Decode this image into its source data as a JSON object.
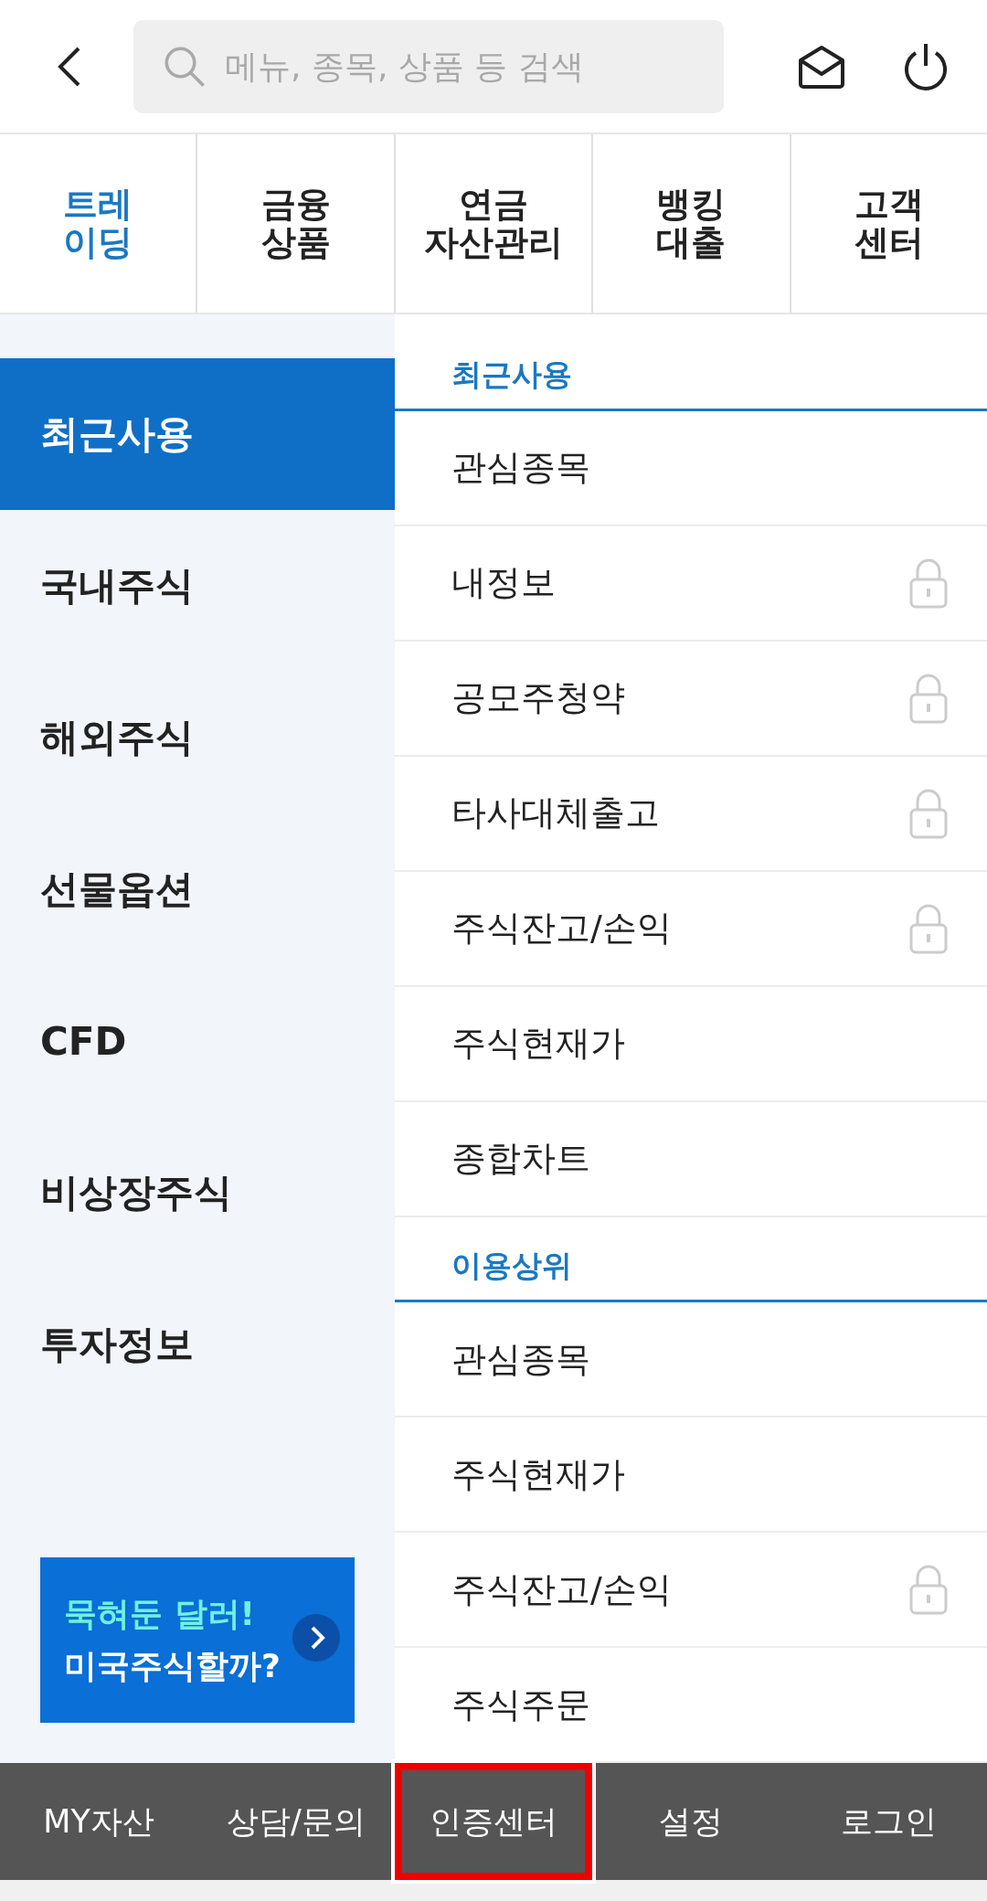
{
  "search": {
    "placeholder": "메뉴, 종목, 상품 등 검색"
  },
  "tabs": [
    {
      "label": "트레\n이딩",
      "selected": true
    },
    {
      "label": "금융\n상품",
      "selected": false
    },
    {
      "label": "연금\n자산관리",
      "selected": false
    },
    {
      "label": "뱅킹\n대출",
      "selected": false
    },
    {
      "label": "고객\n센터",
      "selected": false
    }
  ],
  "sidebar": {
    "items": [
      {
        "label": "최근사용",
        "selected": true
      },
      {
        "label": "국내주식",
        "selected": false
      },
      {
        "label": "해외주식",
        "selected": false
      },
      {
        "label": "선물옵션",
        "selected": false
      },
      {
        "label": "CFD",
        "selected": false
      },
      {
        "label": "비상장주식",
        "selected": false
      },
      {
        "label": "투자정보",
        "selected": false
      }
    ],
    "banner": {
      "line_1": "묵혀둔 달러!",
      "line_2": "미국주식할까?"
    }
  },
  "sections": [
    {
      "title": "최근사용",
      "items": [
        {
          "label": "관심종목",
          "locked": false
        },
        {
          "label": "내정보",
          "locked": true
        },
        {
          "label": "공모주청약",
          "locked": true
        },
        {
          "label": "타사대체출고",
          "locked": true
        },
        {
          "label": "주식잔고/손익",
          "locked": true
        },
        {
          "label": "주식현재가",
          "locked": false
        },
        {
          "label": "종합차트",
          "locked": false
        }
      ]
    },
    {
      "title": "이용상위",
      "items": [
        {
          "label": "관심종목",
          "locked": false
        },
        {
          "label": "주식현재가",
          "locked": false
        },
        {
          "label": "주식잔고/손익",
          "locked": true
        },
        {
          "label": "주식주문",
          "locked": false
        }
      ]
    }
  ],
  "bottom_bar": [
    {
      "label": "MY자산",
      "highlighted": false
    },
    {
      "label": "상담/문의",
      "highlighted": false
    },
    {
      "label": "인증센터",
      "highlighted": true
    },
    {
      "label": "설정",
      "highlighted": false
    },
    {
      "label": "로그인",
      "highlighted": false
    }
  ]
}
